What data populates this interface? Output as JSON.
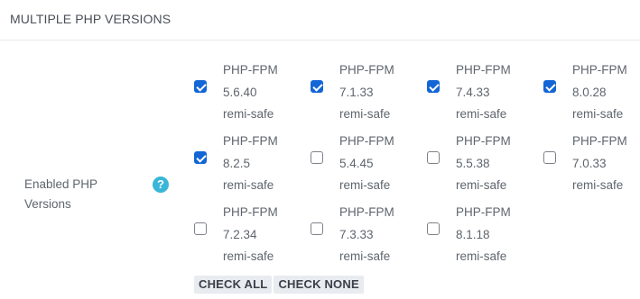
{
  "section": {
    "title": "MULTIPLE PHP VERSIONS"
  },
  "field": {
    "label": "Enabled PHP Versions",
    "help_icon": "question-circle-icon",
    "help_glyph": "?"
  },
  "options": [
    {
      "name": "PHP-FPM",
      "version": "5.6.40",
      "repo": "remi-safe",
      "checked": true
    },
    {
      "name": "PHP-FPM",
      "version": "7.1.33",
      "repo": "remi-safe",
      "checked": true
    },
    {
      "name": "PHP-FPM",
      "version": "7.4.33",
      "repo": "remi-safe",
      "checked": true
    },
    {
      "name": "PHP-FPM",
      "version": "8.0.28",
      "repo": "remi-safe",
      "checked": true
    },
    {
      "name": "PHP-FPM",
      "version": "8.2.5",
      "repo": "remi-safe",
      "checked": true
    },
    {
      "name": "PHP-FPM",
      "version": "5.4.45",
      "repo": "remi-safe",
      "checked": false
    },
    {
      "name": "PHP-FPM",
      "version": "5.5.38",
      "repo": "remi-safe",
      "checked": false
    },
    {
      "name": "PHP-FPM",
      "version": "7.0.33",
      "repo": "remi-safe",
      "checked": false
    },
    {
      "name": "PHP-FPM",
      "version": "7.2.34",
      "repo": "remi-safe",
      "checked": false
    },
    {
      "name": "PHP-FPM",
      "version": "7.3.33",
      "repo": "remi-safe",
      "checked": false
    },
    {
      "name": "PHP-FPM",
      "version": "8.1.18",
      "repo": "remi-safe",
      "checked": false
    }
  ],
  "buttons": {
    "check_all": "CHECK ALL",
    "check_none": "CHECK NONE"
  },
  "colors": {
    "accent": "#1366d6",
    "help": "#3ab6d8"
  }
}
